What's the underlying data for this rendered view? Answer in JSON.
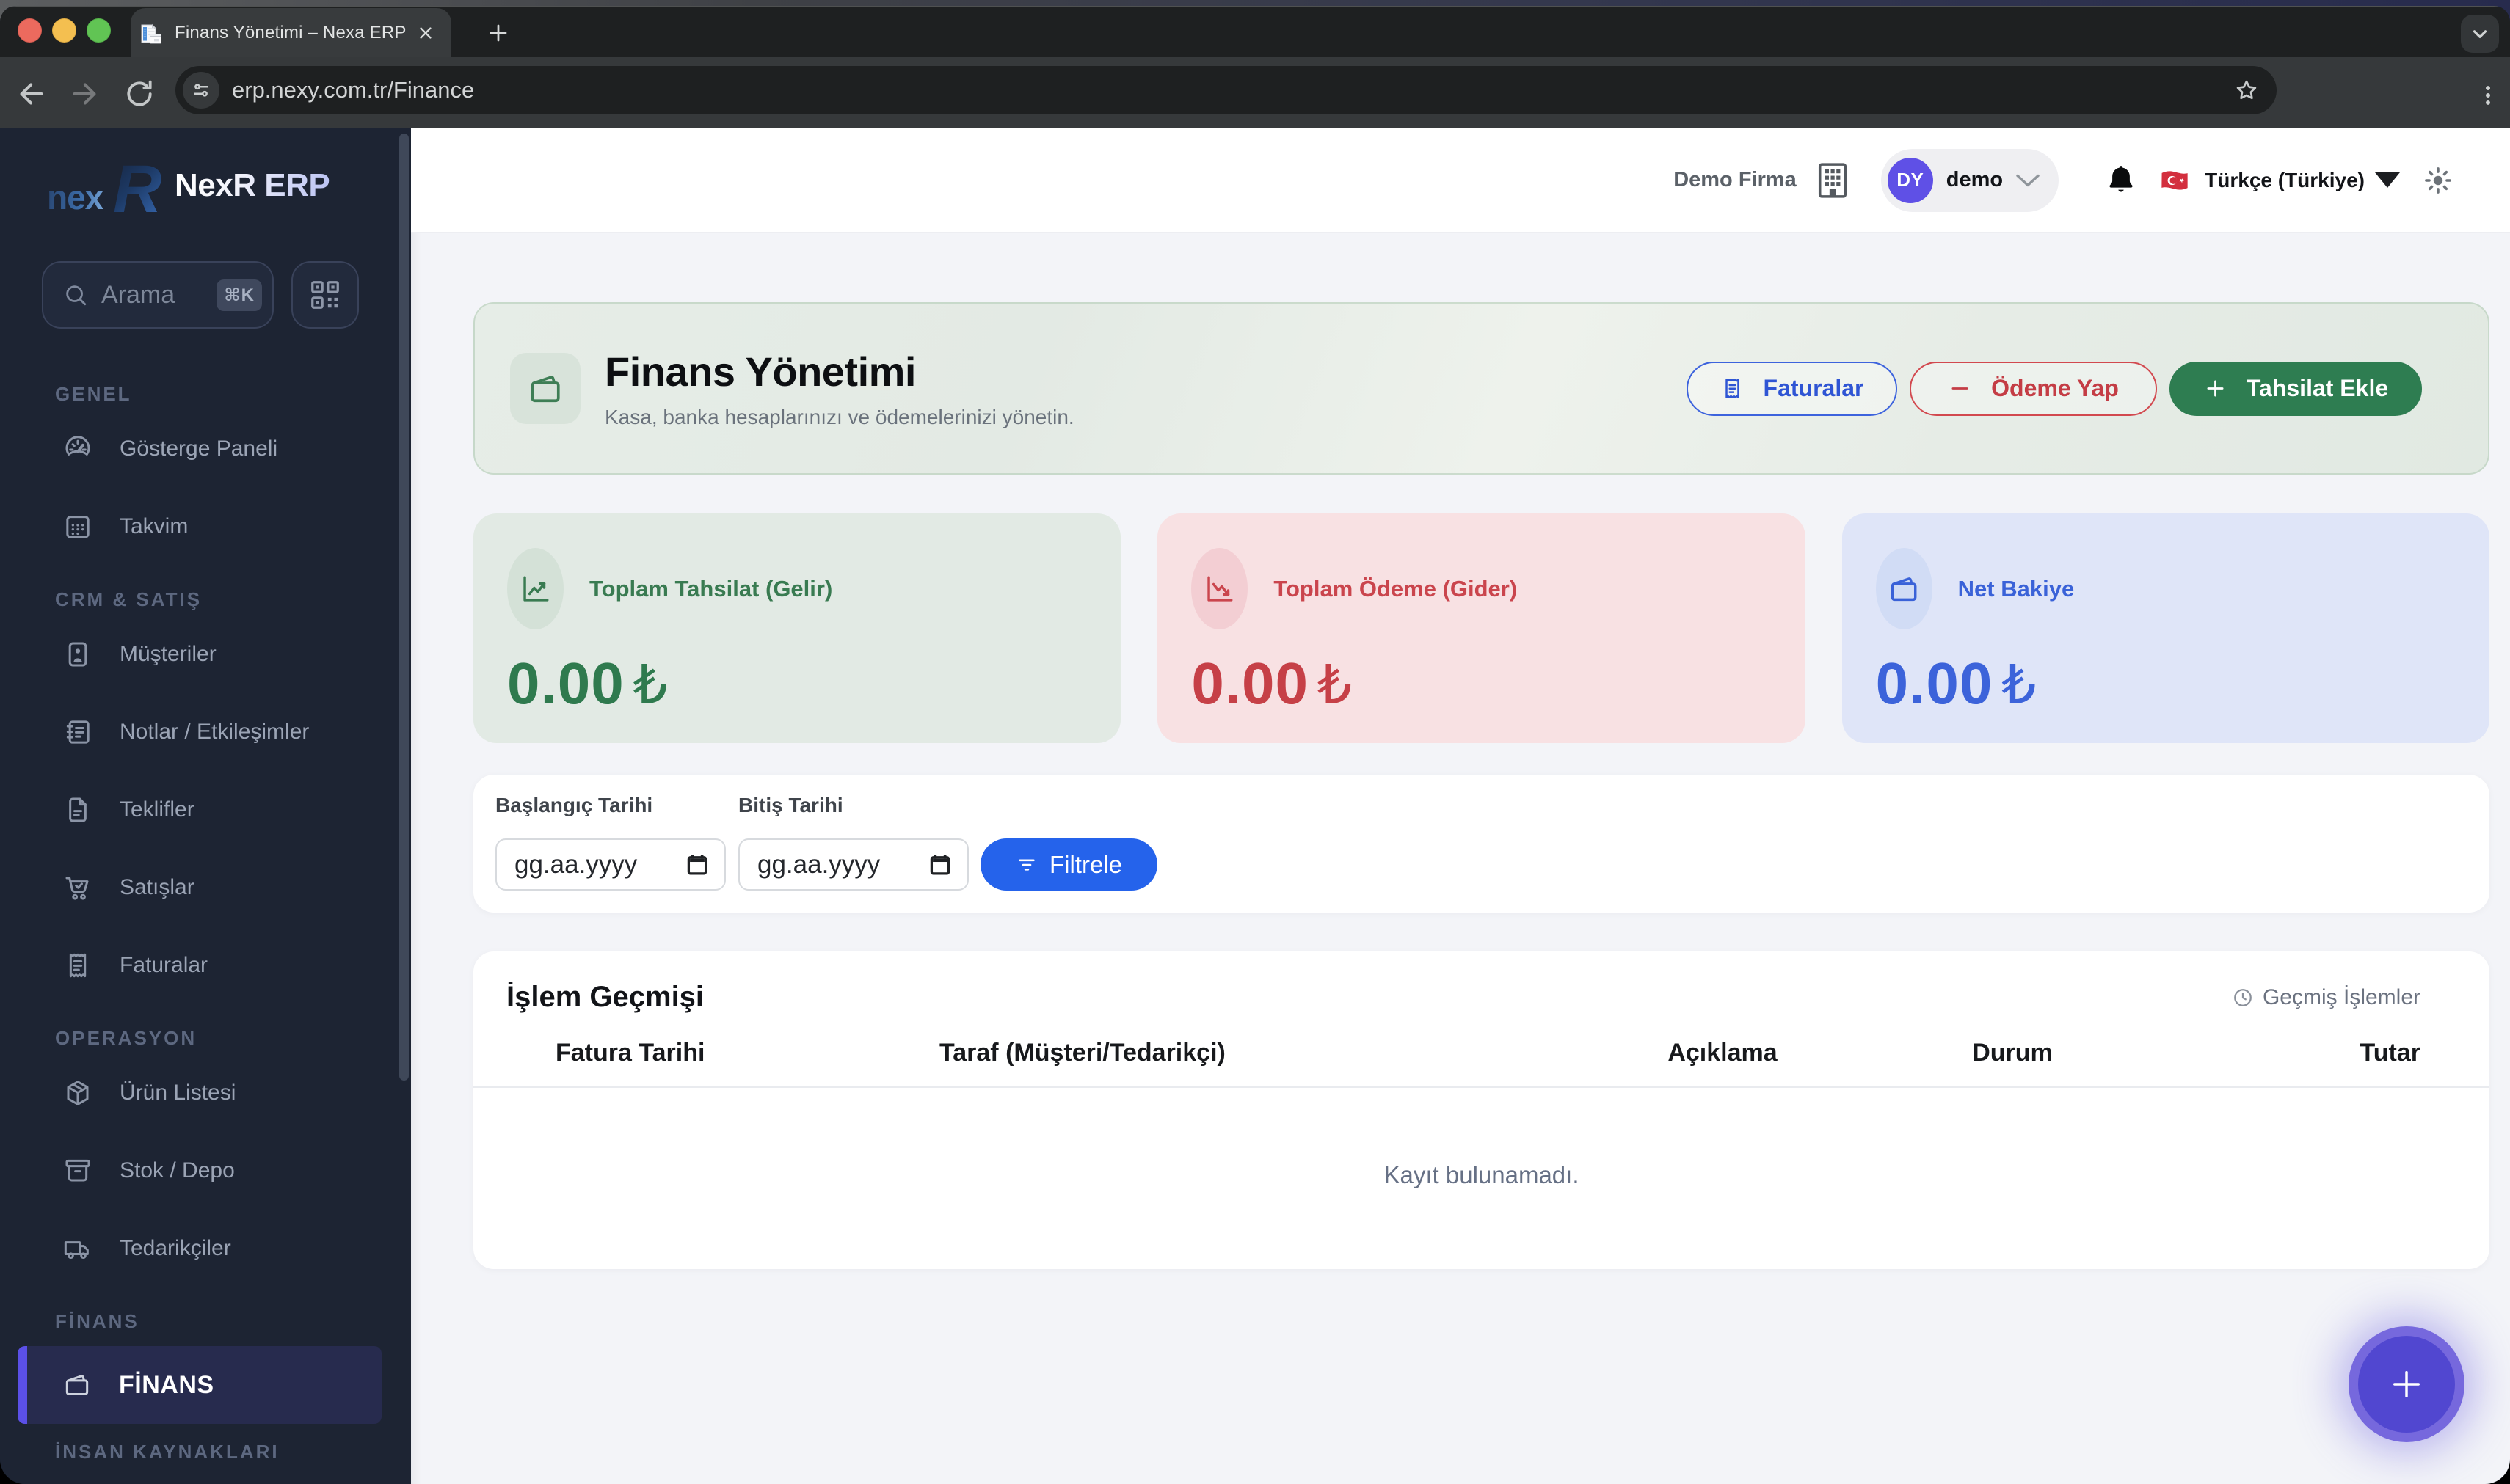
{
  "browser": {
    "tab_title": "Finans Yönetimi – Nexa ERP",
    "url": "erp.nexy.com.tr/Finance"
  },
  "sidebar": {
    "logo_nex": "nex",
    "logo_r": "R",
    "logo_text": "NexR ERP",
    "search": {
      "placeholder": "Arama",
      "shortcut": "⌘K"
    },
    "sections": [
      {
        "label": "GENEL",
        "items": [
          {
            "label": "Gösterge Paneli"
          },
          {
            "label": "Takvim"
          }
        ]
      },
      {
        "label": "CRM & SATIŞ",
        "items": [
          {
            "label": "Müşteriler"
          },
          {
            "label": "Notlar / Etkileşimler"
          },
          {
            "label": "Teklifler"
          },
          {
            "label": "Satışlar"
          },
          {
            "label": "Faturalar"
          }
        ]
      },
      {
        "label": "OPERASYON",
        "items": [
          {
            "label": "Ürün Listesi"
          },
          {
            "label": "Stok / Depo"
          },
          {
            "label": "Tedarikçiler"
          }
        ]
      },
      {
        "label": "FİNANS",
        "items": [
          {
            "label": "FİNANS",
            "active": true
          }
        ]
      },
      {
        "label": "İNSAN KAYNAKLARI",
        "items": []
      }
    ]
  },
  "header": {
    "company": "Demo Firma",
    "user_initials": "DY",
    "user_name": "demo",
    "language": "Türkçe (Türkiye)"
  },
  "hero": {
    "title": "Finans Yönetimi",
    "subtitle": "Kasa, banka hesaplarınızı ve ödemelerinizi yönetin.",
    "btn_invoices": "Faturalar",
    "btn_pay": "Ödeme Yap",
    "btn_collect": "Tahsilat Ekle"
  },
  "stats": [
    {
      "label": "Toplam Tahsilat (Gelir)",
      "value": "0.00",
      "currency": "₺",
      "color": "#2f7a4e"
    },
    {
      "label": "Toplam Ödeme (Gider)",
      "value": "0.00",
      "currency": "₺",
      "color": "#c64047"
    },
    {
      "label": "Net Bakiye",
      "value": "0.00",
      "currency": "₺",
      "color": "#3c63da"
    }
  ],
  "filters": {
    "start_label": "Başlangıç Tarihi",
    "end_label": "Bitiş Tarihi",
    "date_placeholder": "gg.aa.yyyy",
    "button": "Filtrele"
  },
  "table": {
    "title": "İşlem Geçmişi",
    "history_link": "Geçmiş İşlemler",
    "columns": [
      "Fatura Tarihi",
      "Taraf (Müşteri/Tedarikçi)",
      "Açıklama",
      "Durum",
      "Tutar"
    ],
    "rows": [],
    "empty": "Kayıt bulunamadı."
  }
}
